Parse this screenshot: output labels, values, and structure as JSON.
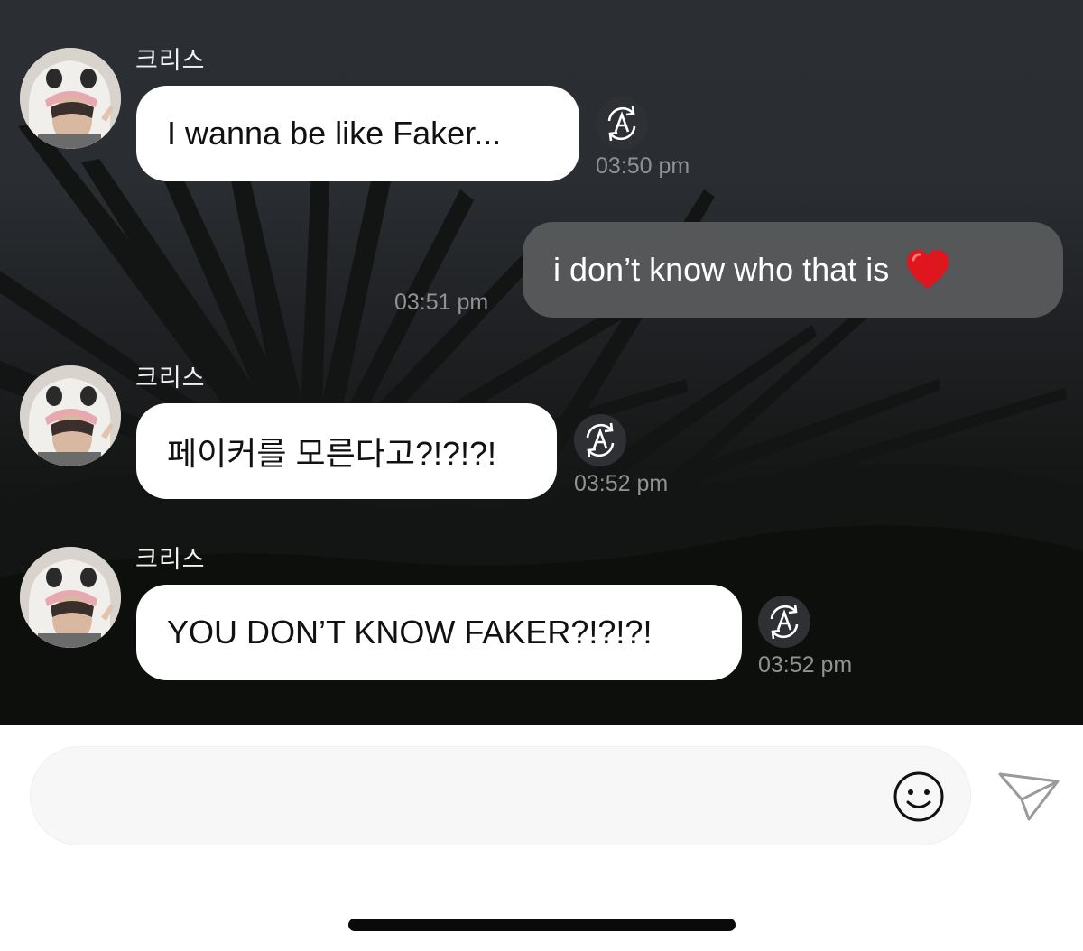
{
  "chat": {
    "messages": [
      {
        "direction": "incoming",
        "sender": "크리스",
        "text": "I wanna be like Faker...",
        "time": "03:50 pm",
        "translate_icon": "auto-translate-icon"
      },
      {
        "direction": "outgoing",
        "text": "i don’t know who that is",
        "emoji": "red-heart",
        "time": "03:51 pm"
      },
      {
        "direction": "incoming",
        "sender": "크리스",
        "text": "페이커를 모른다고?!?!?!",
        "time": "03:52 pm",
        "translate_icon": "auto-translate-icon"
      },
      {
        "direction": "incoming",
        "sender": "크리스",
        "text": "YOU DON’T KNOW FAKER?!?!?!",
        "time": "03:52 pm",
        "translate_icon": "auto-translate-icon"
      }
    ]
  },
  "composer": {
    "input_value": "",
    "emoji_icon": "smiley-face-icon",
    "send_icon": "paper-plane-icon"
  },
  "colors": {
    "incoming_bubble": "#ffffff",
    "outgoing_bubble": "#555758",
    "heart": "#e0161e",
    "timestamp": "#8f9193",
    "chat_background": "#2b2e33"
  }
}
